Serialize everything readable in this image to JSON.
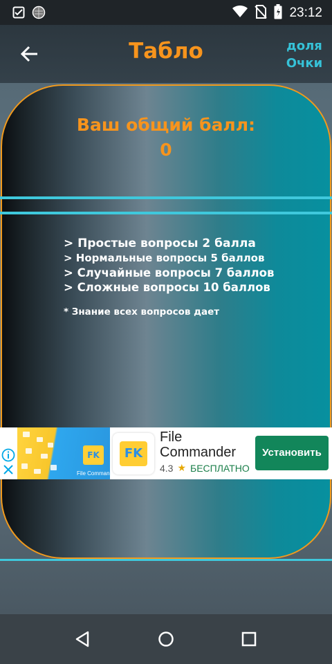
{
  "status_bar": {
    "time": "23:12",
    "left_icons": [
      "checklist-icon",
      "globe-icon"
    ],
    "right_icons": [
      "wifi-icon",
      "no-sim-icon",
      "battery-icon"
    ]
  },
  "app_bar": {
    "back_icon": "arrow-left-icon",
    "title": "Табло",
    "share_label": "доля",
    "points_label": "Очки"
  },
  "scoreboard": {
    "score_label": "Ваш общий балл:",
    "score_value": "0",
    "rules": [
      "> Простые вопросы 2 балла",
      "> Нормальные вопросы 5 баллов",
      "> Случайные вопросы 7 баллов",
      "> Сложные вопросы 10 баллов"
    ],
    "note": "* Знание всех вопросов дает"
  },
  "ad": {
    "app_name": "File Commander",
    "rating": "4.3",
    "price": "БЕСПЛАТНО",
    "install_label": "Установить",
    "logo_text": "FK",
    "image_caption": "File Commander"
  },
  "nav_bar": {
    "icons": [
      "back-triangle-icon",
      "home-circle-icon",
      "recents-square-icon"
    ]
  },
  "colors": {
    "accent_orange": "#f7941d",
    "accent_cyan": "#3fc8dc",
    "install_green": "#12865a"
  }
}
